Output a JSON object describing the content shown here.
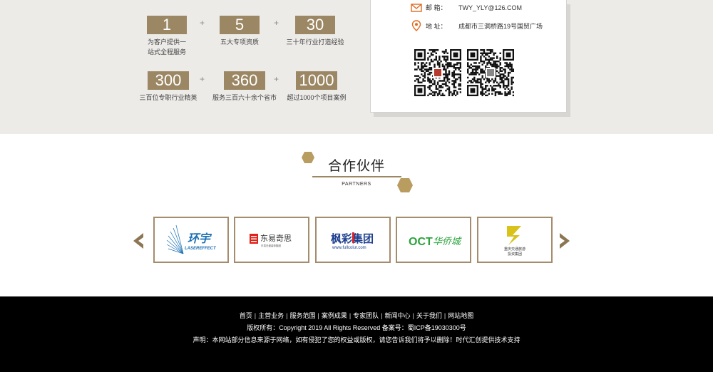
{
  "stats": [
    {
      "value": "1",
      "caption_lines": [
        "为客户提供一",
        "站式全程服务"
      ]
    },
    {
      "value": "5",
      "caption_lines": [
        "五大专项资质"
      ]
    },
    {
      "value": "30",
      "caption_lines": [
        "三十年行业打造经验"
      ]
    },
    {
      "value": "300",
      "caption_lines": [
        "三百位专职行业精英"
      ]
    },
    {
      "value": "360",
      "caption_lines": [
        "服务三百六十余个省市"
      ]
    },
    {
      "value": "1000",
      "caption_lines": [
        "超过1000个项目案例"
      ]
    }
  ],
  "plus_sign": "+",
  "contact": {
    "email_label": "邮  箱：",
    "email_value": "TWY_YLY@126.COM",
    "address_label": "地  址：",
    "address_value": "成都市三洞桥路19号国贸广场",
    "icons": [
      "mail-icon",
      "location-pin-icon"
    ]
  },
  "partners_section": {
    "title": "合作伙伴",
    "subtitle": "PARTNERS",
    "accent_color": "#9c8764",
    "hex_color": "#b99c5f",
    "items": [
      {
        "name": "环宇",
        "sub": "LASEREFFECT",
        "color": "#1a6fb3"
      },
      {
        "name": "东易奇思",
        "sub": "东易日盛装饰集团",
        "color": "#333333",
        "mark_color": "#e0231a"
      },
      {
        "name": "枫彩集团",
        "sub": "www.fullcolur.com",
        "color": "#1d3f8f",
        "accent": "#d5252b"
      },
      {
        "name": "OCT",
        "sub": "华侨城",
        "color": "#2aa33b"
      },
      {
        "name": "重庆交通旅游",
        "sub": "投资集团",
        "color": "#333333",
        "mark_color": "#d9c21a"
      }
    ]
  },
  "footer": {
    "nav": [
      "首页",
      "主营业务",
      "服务范围",
      "案例成果",
      "专家团队",
      "新闻中心",
      "关于我们",
      "网站地图"
    ],
    "separator": "|",
    "copyright": "版权所有：Copyright 2019 All Rights Reserved 备案号：蜀ICP备19030300号",
    "disclaimer": "声明：本网站部分信息来源于网络，如有侵犯了您的权益或版权，请您告诉我们将予以删除！时代汇创提供技术支持"
  }
}
